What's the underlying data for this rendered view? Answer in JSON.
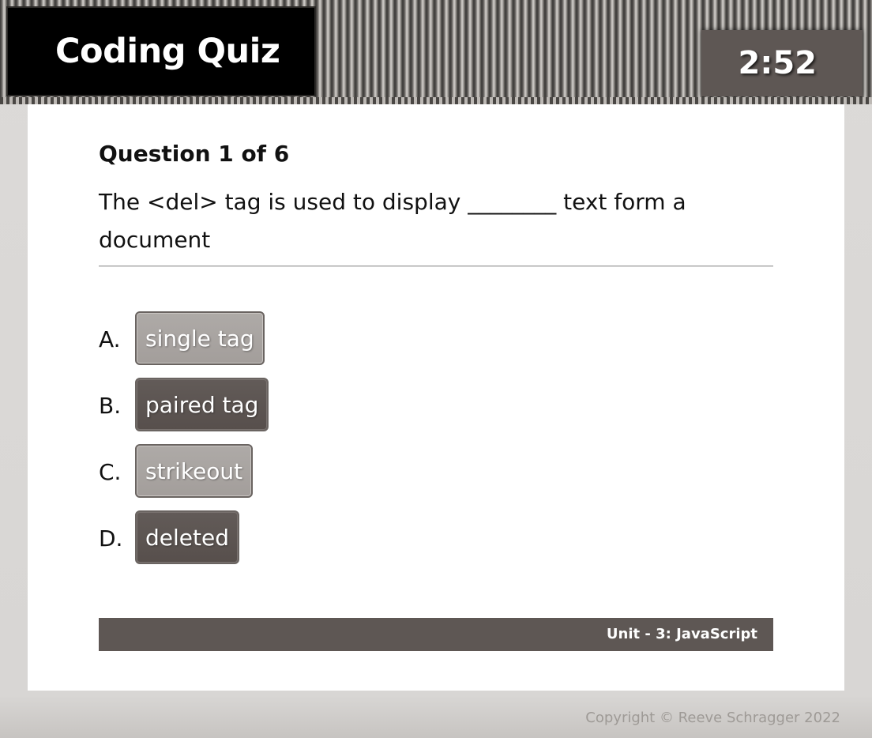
{
  "header": {
    "title": "Coding Quiz",
    "timer": "2:52"
  },
  "question": {
    "counter": "Question 1 of 6",
    "text": "The <del> tag is used to display ________ text form a document"
  },
  "answers": [
    {
      "letter": "A.",
      "label": "single tag",
      "style": "light"
    },
    {
      "letter": "B.",
      "label": "paired tag",
      "style": "dark"
    },
    {
      "letter": "C.",
      "label": "strikeout",
      "style": "light"
    },
    {
      "letter": "D.",
      "label": "deleted",
      "style": "dark"
    }
  ],
  "footer": {
    "unit": "Unit - 3: JavaScript"
  },
  "copyright": "Copyright © Reeve Schragger 2022",
  "colors": {
    "header_dark": "#000000",
    "timer_bg": "#5e5754",
    "answer_light": "#a9a5a2",
    "answer_dark": "#5e5754",
    "footer_bg": "#5e5754"
  }
}
